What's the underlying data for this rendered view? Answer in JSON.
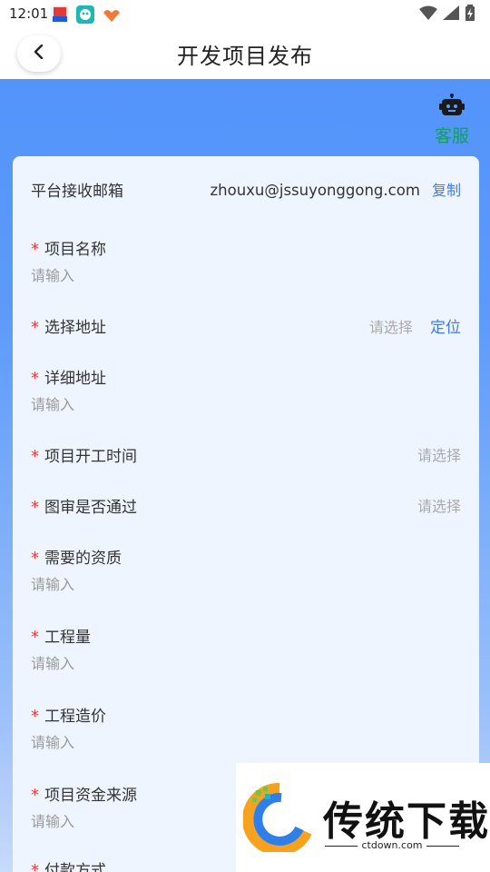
{
  "status": {
    "time": "12:01"
  },
  "header": {
    "title": "开发项目发布"
  },
  "customer_service": {
    "label": "客服"
  },
  "email_row": {
    "label": "平台接收邮箱",
    "value": "zhouxu@jssuyonggong.com",
    "copy": "复制"
  },
  "fields": {
    "project_name": {
      "required": "*",
      "label": "项目名称",
      "placeholder": "请输入"
    },
    "address": {
      "required": "*",
      "label": "选择地址",
      "placeholder": "请选择",
      "action": "定位"
    },
    "detail_address": {
      "required": "*",
      "label": "详细地址",
      "placeholder": "请输入"
    },
    "start_time": {
      "required": "*",
      "label": "项目开工时间",
      "placeholder": "请选择"
    },
    "drawing_review": {
      "required": "*",
      "label": "图审是否通过",
      "placeholder": "请选择"
    },
    "qualification": {
      "required": "*",
      "label": "需要的资质",
      "placeholder": "请输入"
    },
    "quantity": {
      "required": "*",
      "label": "工程量",
      "placeholder": "请输入"
    },
    "cost": {
      "required": "*",
      "label": "工程造价",
      "placeholder": "请输入"
    },
    "fund_source": {
      "required": "*",
      "label": "项目资金来源",
      "placeholder": "请输入"
    },
    "payment": {
      "required": "*",
      "label": "付款方式"
    }
  },
  "watermark": {
    "brand": "传统下载",
    "site": "ctdown.com"
  },
  "colors": {
    "accent": "#3f7be6",
    "band": "#5394fb",
    "required": "#ee3b3b",
    "service": "#14a05a"
  }
}
